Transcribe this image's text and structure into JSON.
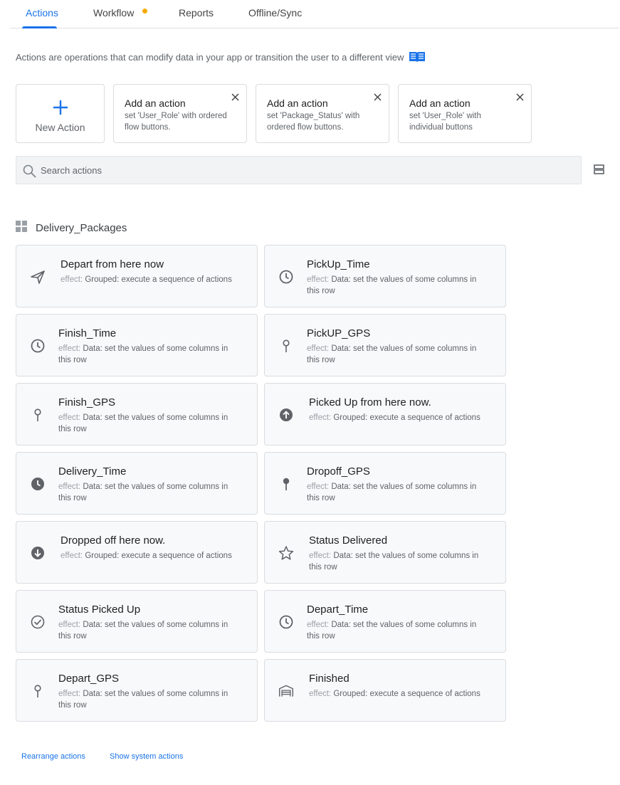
{
  "tabs": [
    {
      "label": "Actions",
      "active": true
    },
    {
      "label": "Workflow",
      "active": false,
      "dot_color": "#f9ab00"
    },
    {
      "label": "Reports",
      "active": false
    },
    {
      "label": "Offline/Sync",
      "active": false
    }
  ],
  "intro_text": "Actions are operations that can modify data in your app or transition the user to a different view",
  "new_action_label": "New Action",
  "suggestions": [
    {
      "title": "Add an action",
      "desc": "set 'User_Role' with ordered flow buttons."
    },
    {
      "title": "Add an action",
      "desc": "set 'Package_Status' with ordered flow buttons."
    },
    {
      "title": "Add an action",
      "desc": "set 'User_Role' with individual buttons"
    }
  ],
  "search": {
    "placeholder": "Search actions",
    "value": ""
  },
  "group": {
    "title": "Delivery_Packages"
  },
  "effect_key": "effect:",
  "actions": [
    {
      "name": "Depart from here now",
      "effect": "Grouped: execute a sequence of actions",
      "icon": "send-icon"
    },
    {
      "name": "PickUp_Time",
      "effect": "Data: set the values of some columns in this row",
      "icon": "clock-icon"
    },
    {
      "name": "Finish_Time",
      "effect": "Data: set the values of some columns in this row",
      "icon": "clock-icon"
    },
    {
      "name": "PickUP_GPS",
      "effect": "Data: set the values of some columns in this row",
      "icon": "pin-icon"
    },
    {
      "name": "Finish_GPS",
      "effect": "Data: set the values of some columns in this row",
      "icon": "pin-icon"
    },
    {
      "name": "Picked Up from here now.",
      "effect": "Grouped: execute a sequence of actions",
      "icon": "arrow-up-circle-icon"
    },
    {
      "name": "Delivery_Time",
      "effect": "Data: set the values of some columns in this row",
      "icon": "clock-filled-icon"
    },
    {
      "name": "Dropoff_GPS",
      "effect": "Data: set the values of some columns in this row",
      "icon": "pin-filled-icon"
    },
    {
      "name": "Dropped off here now.",
      "effect": "Grouped: execute a sequence of actions",
      "icon": "arrow-down-circle-icon"
    },
    {
      "name": "Status Delivered",
      "effect": "Data: set the values of some columns in this row",
      "icon": "star-icon"
    },
    {
      "name": "Status Picked Up",
      "effect": "Data: set the values of some columns in this row",
      "icon": "check-circle-icon"
    },
    {
      "name": "Depart_Time",
      "effect": "Data: set the values of some columns in this row",
      "icon": "clock-icon"
    },
    {
      "name": "Depart_GPS",
      "effect": "Data: set the values of some columns in this row",
      "icon": "pin-icon"
    },
    {
      "name": "Finished",
      "effect": "Grouped: execute a sequence of actions",
      "icon": "garage-icon"
    }
  ],
  "footer": {
    "rearrange": "Rearrange actions",
    "system": "Show system actions"
  },
  "colors": {
    "accent": "#1a73e8",
    "dot": "#f9ab00",
    "icon": "#5f6368"
  }
}
